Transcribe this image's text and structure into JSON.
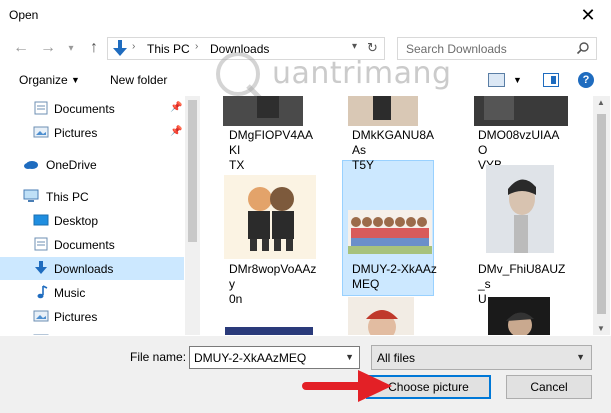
{
  "window": {
    "title": "Open",
    "close_glyph": "✕"
  },
  "nav": {
    "back_icon": "arrow-left-icon",
    "forward_icon": "arrow-right-icon",
    "recent_icon": "chevron-down-icon",
    "up_icon": "arrow-up-icon",
    "breadcrumbs": [
      "This PC",
      "Downloads"
    ],
    "search_placeholder": "Search Downloads"
  },
  "toolbar": {
    "organize_label": "Organize",
    "new_folder_label": "New folder",
    "help_label": "?"
  },
  "watermark": {
    "text": "uantrimang"
  },
  "sidebar": {
    "items": [
      {
        "label": "Documents",
        "icon": "documents-folder-icon",
        "pinned": true
      },
      {
        "label": "Pictures",
        "icon": "pictures-folder-icon",
        "pinned": true
      },
      {
        "label": "OneDrive",
        "icon": "cloud-icon"
      },
      {
        "label": "This PC",
        "icon": "computer-icon"
      },
      {
        "label": "Desktop",
        "icon": "desktop-folder-icon"
      },
      {
        "label": "Documents",
        "icon": "documents-folder-icon"
      },
      {
        "label": "Downloads",
        "icon": "download-folder-icon",
        "selected": true
      },
      {
        "label": "Music",
        "icon": "music-icon"
      },
      {
        "label": "Pictures",
        "icon": "pictures-folder-icon"
      },
      {
        "label": "",
        "icon": "folder-icon"
      }
    ]
  },
  "files": [
    {
      "name": "DMgFIOPV4AAKITX",
      "line1": "DMgFIOPV4AAKI",
      "line2": "TX"
    },
    {
      "name": "DMkKGANU8AAsT5Y",
      "line1": "DMkKGANU8AAs",
      "line2": "T5Y"
    },
    {
      "name": "DMO08vzUIAAOVYB",
      "line1": "DMO08vzUIAAO",
      "line2": "VYB"
    },
    {
      "name": "DMr8wopVoAAzy0n",
      "line1": "DMr8wopVoAAzy",
      "line2": "0n"
    },
    {
      "name": "DMUY-2-XkAAzMEQ",
      "line1": "DMUY-2-XkAAz",
      "line2": "MEQ",
      "selected": true
    },
    {
      "name": "DMv_FhiU8AUZ_sU",
      "line1": "DMv_FhiU8AUZ_s",
      "line2": "U"
    }
  ],
  "footer": {
    "file_name_label": "File name:",
    "file_name_value": "DMUY-2-XkAAzMEQ",
    "filter_value": "All files",
    "choose_label": "Choose picture",
    "cancel_label": "Cancel"
  },
  "colors": {
    "selection": "#cce8ff",
    "accent": "#0078d7",
    "annotation_arrow": "#e32026"
  }
}
